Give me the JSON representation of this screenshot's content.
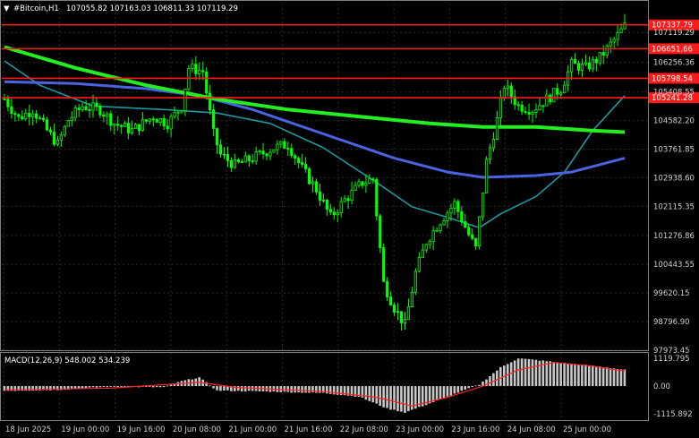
{
  "header": {
    "arrow": "▼",
    "symbol": "#Bitcoin,H1",
    "ohlc": "107055.82 107163.03 106811.33 107119.29"
  },
  "colors": {
    "background": "#000000",
    "grid": "#2a2a2a",
    "axis_text": "#d0d0d0",
    "level_line": "#ff1a1a",
    "bull_candle": "#00ff00",
    "ma_fast": "#1a9aa0",
    "ma_mid": "#4a63e0",
    "ma_slow": "#22ee22",
    "macd_hist": "#c8c8c8",
    "macd_signal": "#ff2222"
  },
  "price_axis": {
    "ticks": [
      "107119.29",
      "106256.36",
      "105408.55",
      "104582.20",
      "103761.85",
      "102938.60",
      "102115.35",
      "101276.86",
      "100443.55",
      "99620.15",
      "98796.90",
      "97973.45"
    ]
  },
  "level_labels": [
    {
      "text": "107337.79",
      "price": 107337.79
    },
    {
      "text": "106651.66",
      "price": 106651.66
    },
    {
      "text": "105798.54",
      "price": 105798.54
    },
    {
      "text": "105241.28",
      "price": 105241.28
    }
  ],
  "macd": {
    "title": "MACD(12,26,9) 548.002 534.239",
    "ticks": [
      "1119.795",
      "0.00",
      "-1115.892"
    ]
  },
  "time_axis": {
    "labels": [
      "18 Jun 2025",
      "19 Jun 00:00",
      "19 Jun 16:00",
      "20 Jun 08:00",
      "21 Jun 00:00",
      "21 Jun 16:00",
      "22 Jun 08:00",
      "23 Jun 00:00",
      "23 Jun 16:00",
      "24 Jun 08:00",
      "25 Jun 00:00"
    ]
  },
  "chart_data": {
    "type": "candlestick",
    "instrument": "#Bitcoin",
    "timeframe": "H1",
    "price_range": [
      97973.45,
      107950
    ],
    "horizontal_levels": [
      107337.79,
      106651.66,
      105798.54,
      105241.28
    ],
    "price_path": [
      {
        "t": 0,
        "p": 105200
      },
      {
        "t": 4,
        "p": 104650
      },
      {
        "t": 8,
        "p": 104900
      },
      {
        "t": 12,
        "p": 104300
      },
      {
        "t": 15,
        "p": 103900
      },
      {
        "t": 18,
        "p": 104600
      },
      {
        "t": 22,
        "p": 105000
      },
      {
        "t": 27,
        "p": 104900
      },
      {
        "t": 31,
        "p": 104500
      },
      {
        "t": 36,
        "p": 104300
      },
      {
        "t": 42,
        "p": 104700
      },
      {
        "t": 46,
        "p": 104500
      },
      {
        "t": 50,
        "p": 105000
      },
      {
        "t": 52,
        "p": 106100
      },
      {
        "t": 56,
        "p": 106000
      },
      {
        "t": 59,
        "p": 104200
      },
      {
        "t": 61,
        "p": 103600
      },
      {
        "t": 65,
        "p": 103300
      },
      {
        "t": 70,
        "p": 103500
      },
      {
        "t": 76,
        "p": 103800
      },
      {
        "t": 80,
        "p": 103900
      },
      {
        "t": 84,
        "p": 103200
      },
      {
        "t": 88,
        "p": 102600
      },
      {
        "t": 92,
        "p": 101800
      },
      {
        "t": 96,
        "p": 102300
      },
      {
        "t": 101,
        "p": 102800
      },
      {
        "t": 104,
        "p": 102900
      },
      {
        "t": 107,
        "p": 99900
      },
      {
        "t": 110,
        "p": 99200
      },
      {
        "t": 113,
        "p": 98700
      },
      {
        "t": 116,
        "p": 100200
      },
      {
        "t": 119,
        "p": 101100
      },
      {
        "t": 123,
        "p": 101700
      },
      {
        "t": 127,
        "p": 102200
      },
      {
        "t": 131,
        "p": 101300
      },
      {
        "t": 133,
        "p": 100900
      },
      {
        "t": 136,
        "p": 103400
      },
      {
        "t": 139,
        "p": 104600
      },
      {
        "t": 141,
        "p": 105600
      },
      {
        "t": 145,
        "p": 105000
      },
      {
        "t": 149,
        "p": 104900
      },
      {
        "t": 153,
        "p": 105200
      },
      {
        "t": 157,
        "p": 105500
      },
      {
        "t": 160,
        "p": 106200
      },
      {
        "t": 164,
        "p": 106100
      },
      {
        "t": 168,
        "p": 106400
      },
      {
        "t": 172,
        "p": 106900
      },
      {
        "t": 175,
        "p": 107300
      }
    ],
    "ma_fast": [
      {
        "t": 0,
        "p": 106300
      },
      {
        "t": 10,
        "p": 105600
      },
      {
        "t": 25,
        "p": 105000
      },
      {
        "t": 45,
        "p": 104900
      },
      {
        "t": 60,
        "p": 104800
      },
      {
        "t": 75,
        "p": 104500
      },
      {
        "t": 90,
        "p": 103800
      },
      {
        "t": 105,
        "p": 102800
      },
      {
        "t": 115,
        "p": 102100
      },
      {
        "t": 125,
        "p": 101800
      },
      {
        "t": 134,
        "p": 101500
      },
      {
        "t": 140,
        "p": 101900
      },
      {
        "t": 150,
        "p": 102400
      },
      {
        "t": 158,
        "p": 103100
      },
      {
        "t": 166,
        "p": 104300
      },
      {
        "t": 175,
        "p": 105300
      }
    ],
    "ma_mid": [
      {
        "t": 0,
        "p": 105700
      },
      {
        "t": 20,
        "p": 105650
      },
      {
        "t": 40,
        "p": 105500
      },
      {
        "t": 55,
        "p": 105300
      },
      {
        "t": 70,
        "p": 104900
      },
      {
        "t": 90,
        "p": 104200
      },
      {
        "t": 110,
        "p": 103500
      },
      {
        "t": 125,
        "p": 103100
      },
      {
        "t": 135,
        "p": 102950
      },
      {
        "t": 150,
        "p": 103000
      },
      {
        "t": 160,
        "p": 103100
      },
      {
        "t": 175,
        "p": 103500
      }
    ],
    "ma_slow": [
      {
        "t": 0,
        "p": 106700
      },
      {
        "t": 20,
        "p": 106100
      },
      {
        "t": 40,
        "p": 105600
      },
      {
        "t": 60,
        "p": 105200
      },
      {
        "t": 80,
        "p": 104900
      },
      {
        "t": 100,
        "p": 104700
      },
      {
        "t": 120,
        "p": 104500
      },
      {
        "t": 135,
        "p": 104400
      },
      {
        "t": 150,
        "p": 104400
      },
      {
        "t": 165,
        "p": 104300
      },
      {
        "t": 175,
        "p": 104250
      }
    ],
    "macd_indicator": {
      "params": [
        12,
        26,
        9
      ],
      "main": 548.002,
      "signal": 534.239,
      "range": [
        -1115.892,
        1119.795
      ],
      "histogram": [
        {
          "t": 0,
          "v": -190
        },
        {
          "t": 15,
          "v": -150
        },
        {
          "t": 30,
          "v": -20
        },
        {
          "t": 45,
          "v": -50
        },
        {
          "t": 50,
          "v": 200
        },
        {
          "t": 55,
          "v": 350
        },
        {
          "t": 60,
          "v": -180
        },
        {
          "t": 75,
          "v": -220
        },
        {
          "t": 90,
          "v": -280
        },
        {
          "t": 100,
          "v": -420
        },
        {
          "t": 108,
          "v": -900
        },
        {
          "t": 113,
          "v": -1060
        },
        {
          "t": 120,
          "v": -700
        },
        {
          "t": 128,
          "v": -260
        },
        {
          "t": 134,
          "v": 60
        },
        {
          "t": 140,
          "v": 750
        },
        {
          "t": 145,
          "v": 1120
        },
        {
          "t": 150,
          "v": 1050
        },
        {
          "t": 160,
          "v": 900
        },
        {
          "t": 170,
          "v": 760
        },
        {
          "t": 175,
          "v": 650
        }
      ],
      "signal_line": [
        {
          "t": 0,
          "v": -150
        },
        {
          "t": 30,
          "v": -80
        },
        {
          "t": 55,
          "v": 150
        },
        {
          "t": 65,
          "v": -50
        },
        {
          "t": 90,
          "v": -220
        },
        {
          "t": 105,
          "v": -450
        },
        {
          "t": 115,
          "v": -800
        },
        {
          "t": 125,
          "v": -450
        },
        {
          "t": 135,
          "v": 0
        },
        {
          "t": 145,
          "v": 650
        },
        {
          "t": 155,
          "v": 950
        },
        {
          "t": 165,
          "v": 820
        },
        {
          "t": 175,
          "v": 600
        }
      ]
    }
  }
}
